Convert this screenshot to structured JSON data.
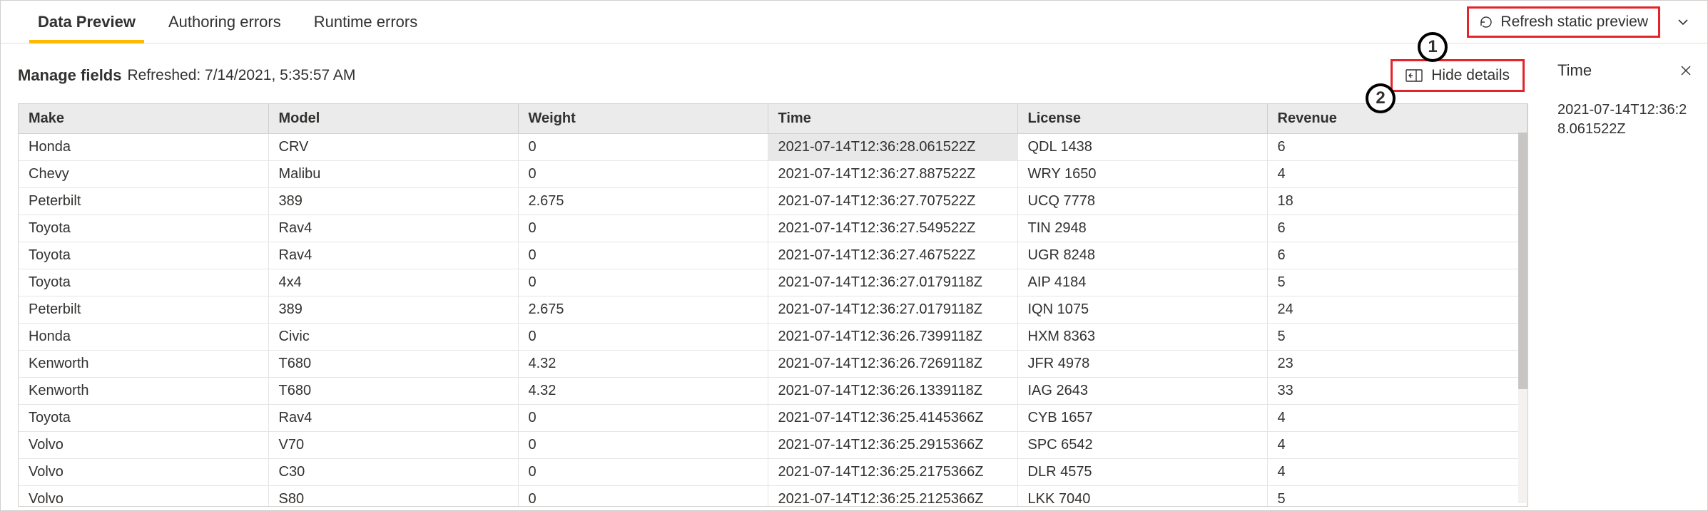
{
  "tabs": {
    "items": [
      {
        "label": "Data Preview",
        "active": true
      },
      {
        "label": "Authoring errors",
        "active": false
      },
      {
        "label": "Runtime errors",
        "active": false
      }
    ],
    "refresh_label": "Refresh static preview"
  },
  "subheader": {
    "title": "Manage fields",
    "refreshed": "Refreshed: 7/14/2021, 5:35:57 AM",
    "hide_details_label": "Hide details"
  },
  "details": {
    "title": "Time",
    "value": "2021-07-14T12:36:28.061522Z"
  },
  "callouts": {
    "one": "1",
    "two": "2"
  },
  "table": {
    "columns": [
      "Make",
      "Model",
      "Weight",
      "Time",
      "License",
      "Revenue"
    ],
    "selected_cell": {
      "row": 0,
      "col": 3
    },
    "rows": [
      {
        "c": [
          "Honda",
          "CRV",
          "0",
          "2021-07-14T12:36:28.061522Z",
          "QDL 1438",
          "6"
        ]
      },
      {
        "c": [
          "Chevy",
          "Malibu",
          "0",
          "2021-07-14T12:36:27.887522Z",
          "WRY 1650",
          "4"
        ]
      },
      {
        "c": [
          "Peterbilt",
          "389",
          "2.675",
          "2021-07-14T12:36:27.707522Z",
          "UCQ 7778",
          "18"
        ]
      },
      {
        "c": [
          "Toyota",
          "Rav4",
          "0",
          "2021-07-14T12:36:27.549522Z",
          "TIN 2948",
          "6"
        ]
      },
      {
        "c": [
          "Toyota",
          "Rav4",
          "0",
          "2021-07-14T12:36:27.467522Z",
          "UGR 8248",
          "6"
        ]
      },
      {
        "c": [
          "Toyota",
          "4x4",
          "0",
          "2021-07-14T12:36:27.0179118Z",
          "AIP 4184",
          "5"
        ]
      },
      {
        "c": [
          "Peterbilt",
          "389",
          "2.675",
          "2021-07-14T12:36:27.0179118Z",
          "IQN 1075",
          "24"
        ]
      },
      {
        "c": [
          "Honda",
          "Civic",
          "0",
          "2021-07-14T12:36:26.7399118Z",
          "HXM 8363",
          "5"
        ]
      },
      {
        "c": [
          "Kenworth",
          "T680",
          "4.32",
          "2021-07-14T12:36:26.7269118Z",
          "JFR 4978",
          "23"
        ]
      },
      {
        "c": [
          "Kenworth",
          "T680",
          "4.32",
          "2021-07-14T12:36:26.1339118Z",
          "IAG 2643",
          "33"
        ]
      },
      {
        "c": [
          "Toyota",
          "Rav4",
          "0",
          "2021-07-14T12:36:25.4145366Z",
          "CYB 1657",
          "4"
        ]
      },
      {
        "c": [
          "Volvo",
          "V70",
          "0",
          "2021-07-14T12:36:25.2915366Z",
          "SPC 6542",
          "4"
        ]
      },
      {
        "c": [
          "Volvo",
          "C30",
          "0",
          "2021-07-14T12:36:25.2175366Z",
          "DLR 4575",
          "4"
        ]
      },
      {
        "c": [
          "Volvo",
          "S80",
          "0",
          "2021-07-14T12:36:25.2125366Z",
          "LKK 7040",
          "5"
        ]
      }
    ]
  }
}
